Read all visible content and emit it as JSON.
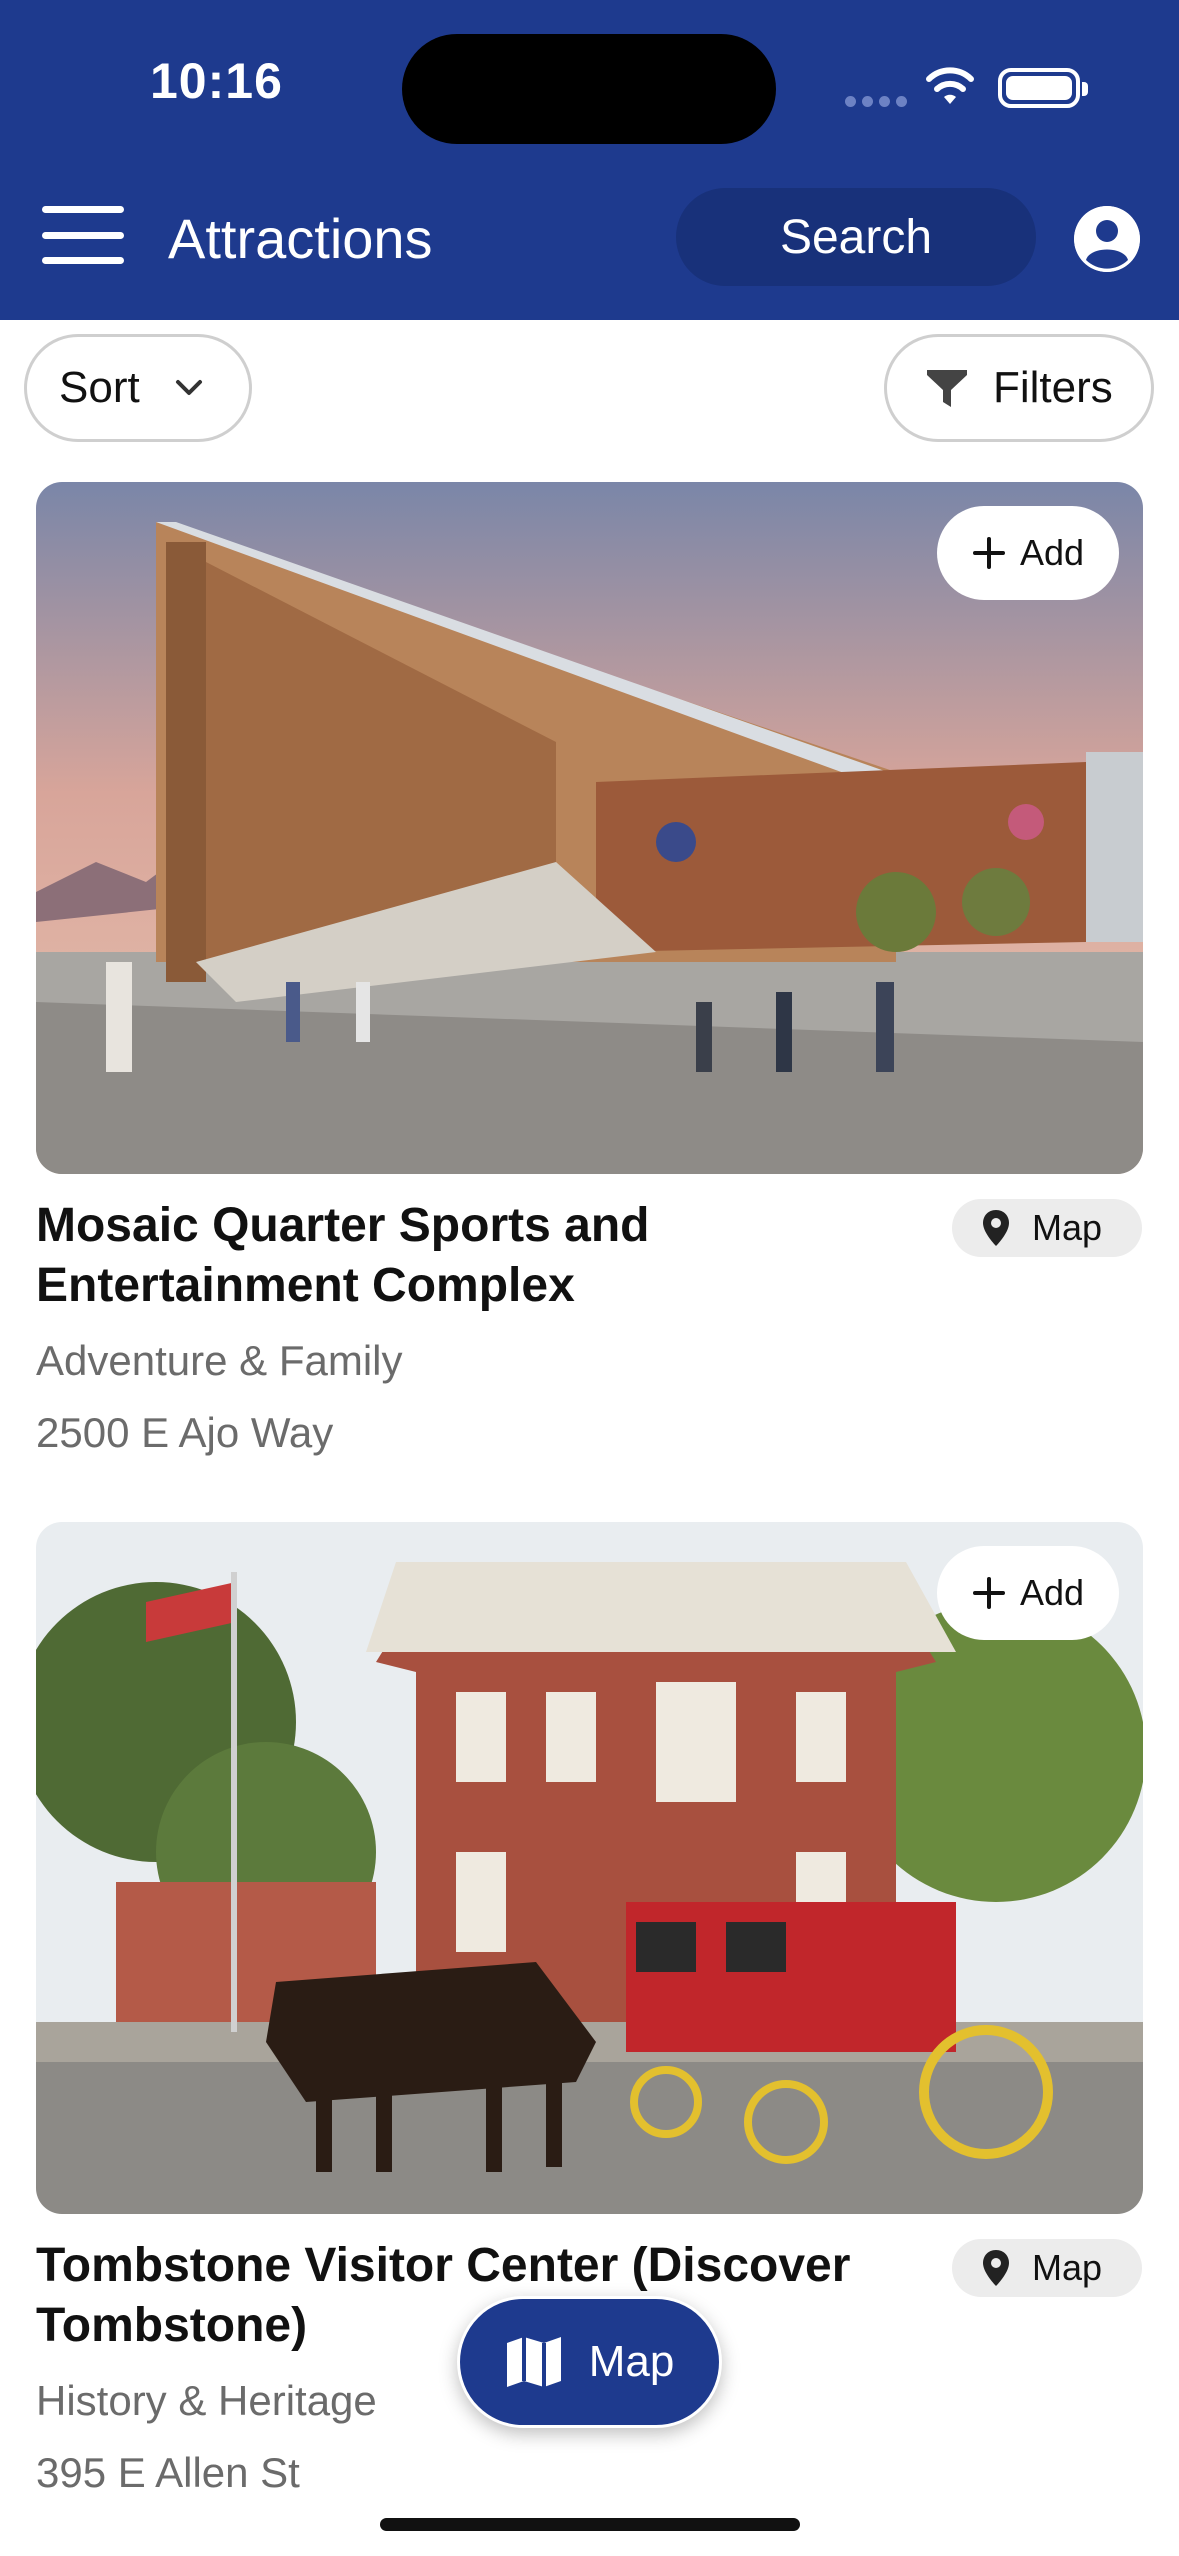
{
  "status_bar": {
    "time": "10:16"
  },
  "header": {
    "title": "Attractions",
    "search_label": "Search"
  },
  "toolbar": {
    "sort_label": "Sort",
    "filters_label": "Filters"
  },
  "cards": [
    {
      "title": "Mosaic Quarter Sports and Entertainment Complex",
      "category": "Adventure & Family",
      "address": "2500 E Ajo Way",
      "add_label": "Add",
      "map_label": "Map"
    },
    {
      "title": "Tombstone Visitor Center (Discover Tombstone)",
      "category": "History & Heritage",
      "address": "395 E Allen St",
      "add_label": "Add",
      "map_label": "Map"
    }
  ],
  "fab": {
    "map_label": "Map"
  },
  "icons": [
    "menu-icon",
    "profile-icon",
    "chevron-down-icon",
    "filter-icon",
    "plus-icon",
    "location-pin-icon",
    "map-icon",
    "wifi-icon",
    "battery-icon"
  ],
  "colors": {
    "brand": "#1e3a8e",
    "search_bg": "#18317a",
    "chip_bg": "#ececec",
    "muted_text": "#6b6b6b"
  }
}
